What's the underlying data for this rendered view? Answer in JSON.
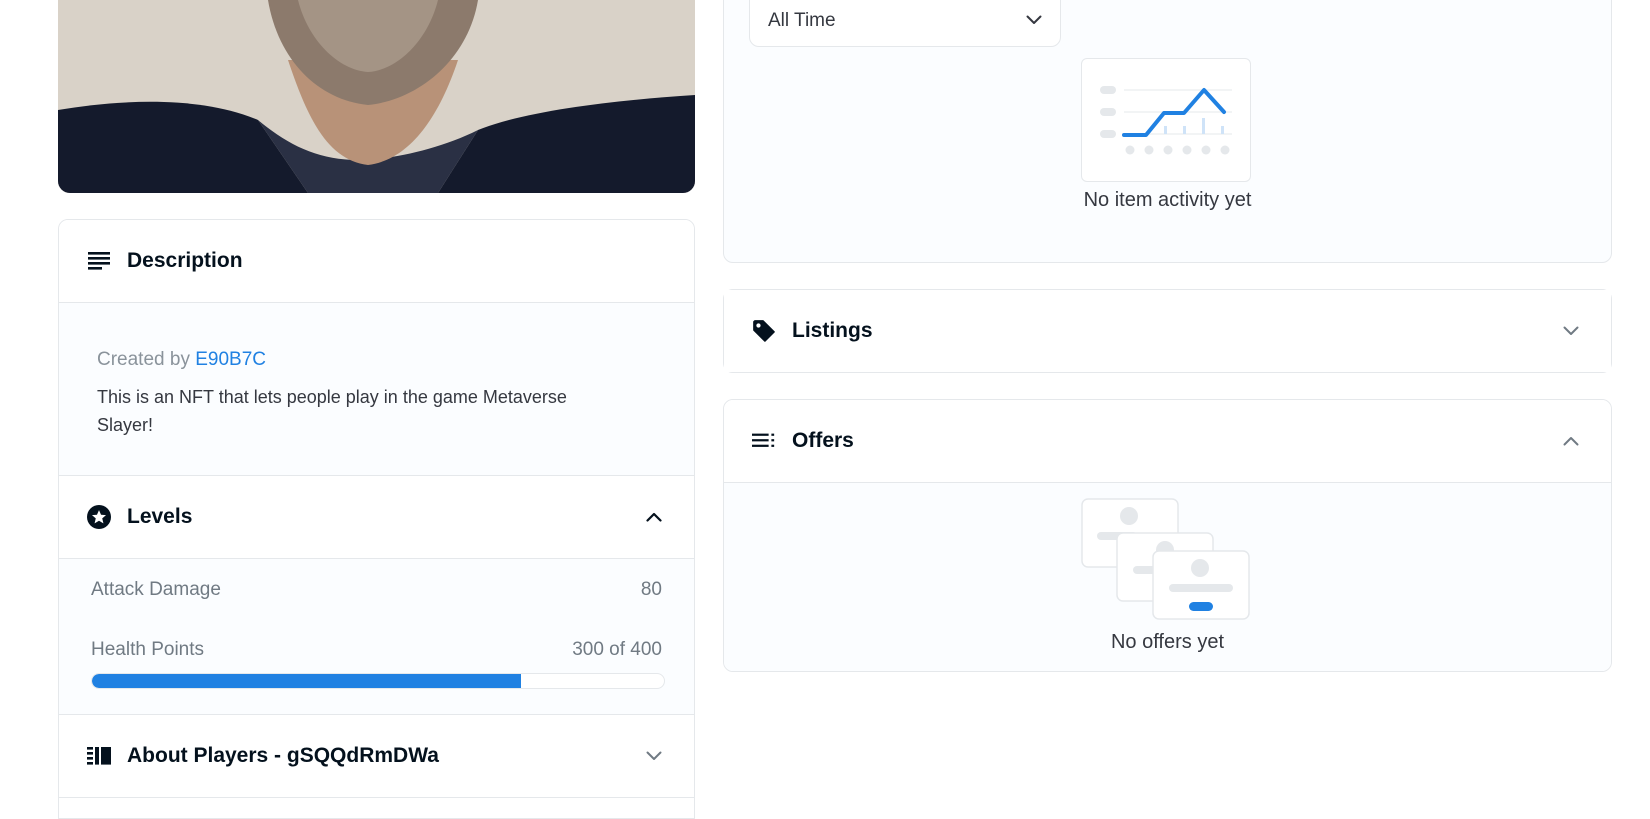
{
  "description": {
    "title": "Description",
    "created_by_label": "Created by",
    "creator": "E90B7C",
    "text": "This is an NFT that lets people play in the game Metaverse Slayer!"
  },
  "levels": {
    "title": "Levels",
    "items": [
      {
        "label": "Attack Damage",
        "value": "80"
      },
      {
        "label": "Health Points",
        "value": "300 of 400",
        "current": 300,
        "max": 400
      }
    ]
  },
  "about": {
    "title": "About Players - gSQQdRmDWa"
  },
  "activity": {
    "filter_value": "All Time",
    "empty_text": "No item activity yet"
  },
  "listings": {
    "title": "Listings"
  },
  "offers": {
    "title": "Offers",
    "empty_text": "No offers yet"
  },
  "colors": {
    "accent": "#2081e2",
    "border": "#e5e8eb",
    "text_dark": "#04111d",
    "text_muted": "#707a83",
    "panel_bg": "#fbfdff"
  }
}
